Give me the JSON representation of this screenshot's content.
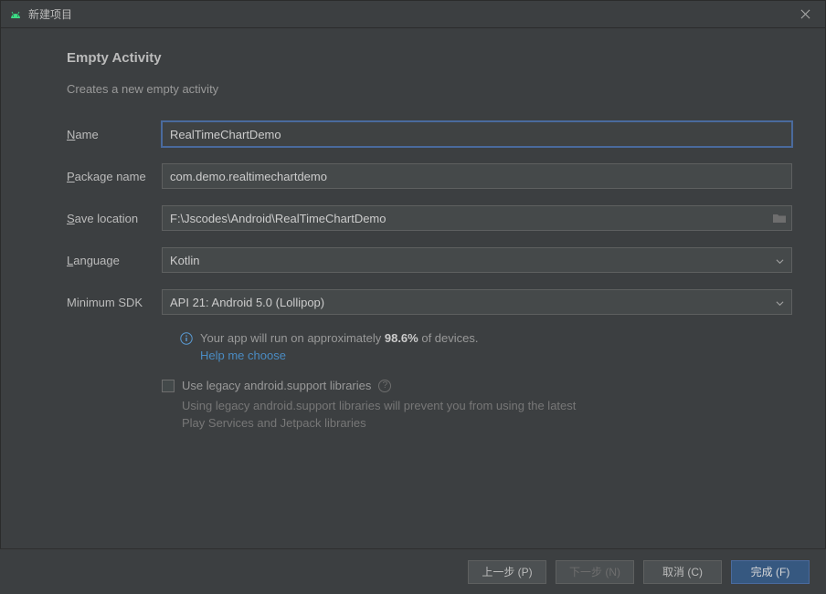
{
  "window": {
    "title": "新建项目"
  },
  "heading": "Empty Activity",
  "subheading": "Creates a new empty activity",
  "form": {
    "name": {
      "label_pre": "N",
      "label_rest": "ame",
      "value": "RealTimeChartDemo"
    },
    "packageName": {
      "label_pre": "P",
      "label_rest": "ackage name",
      "value": "com.demo.realtimechartdemo"
    },
    "saveLocation": {
      "label_pre": "S",
      "label_rest": "ave location",
      "value": "F:\\Jscodes\\Android\\RealTimeChartDemo"
    },
    "language": {
      "label_pre": "L",
      "label_rest": "anguage",
      "value": "Kotlin"
    },
    "minSdk": {
      "label": "Minimum SDK",
      "value": "API 21: Android 5.0 (Lollipop)"
    }
  },
  "info": {
    "prefix": "Your app will run on approximately ",
    "percent": "98.6%",
    "suffix": " of devices.",
    "help_link": "Help me choose"
  },
  "legacy": {
    "label": "Use legacy android.support libraries",
    "desc": "Using legacy android.support libraries will prevent you from using the latest Play Services and Jetpack libraries"
  },
  "buttons": {
    "prev": "上一步 (P)",
    "next": "下一步 (N)",
    "cancel": "取消 (C)",
    "finish": "完成 (F)"
  }
}
